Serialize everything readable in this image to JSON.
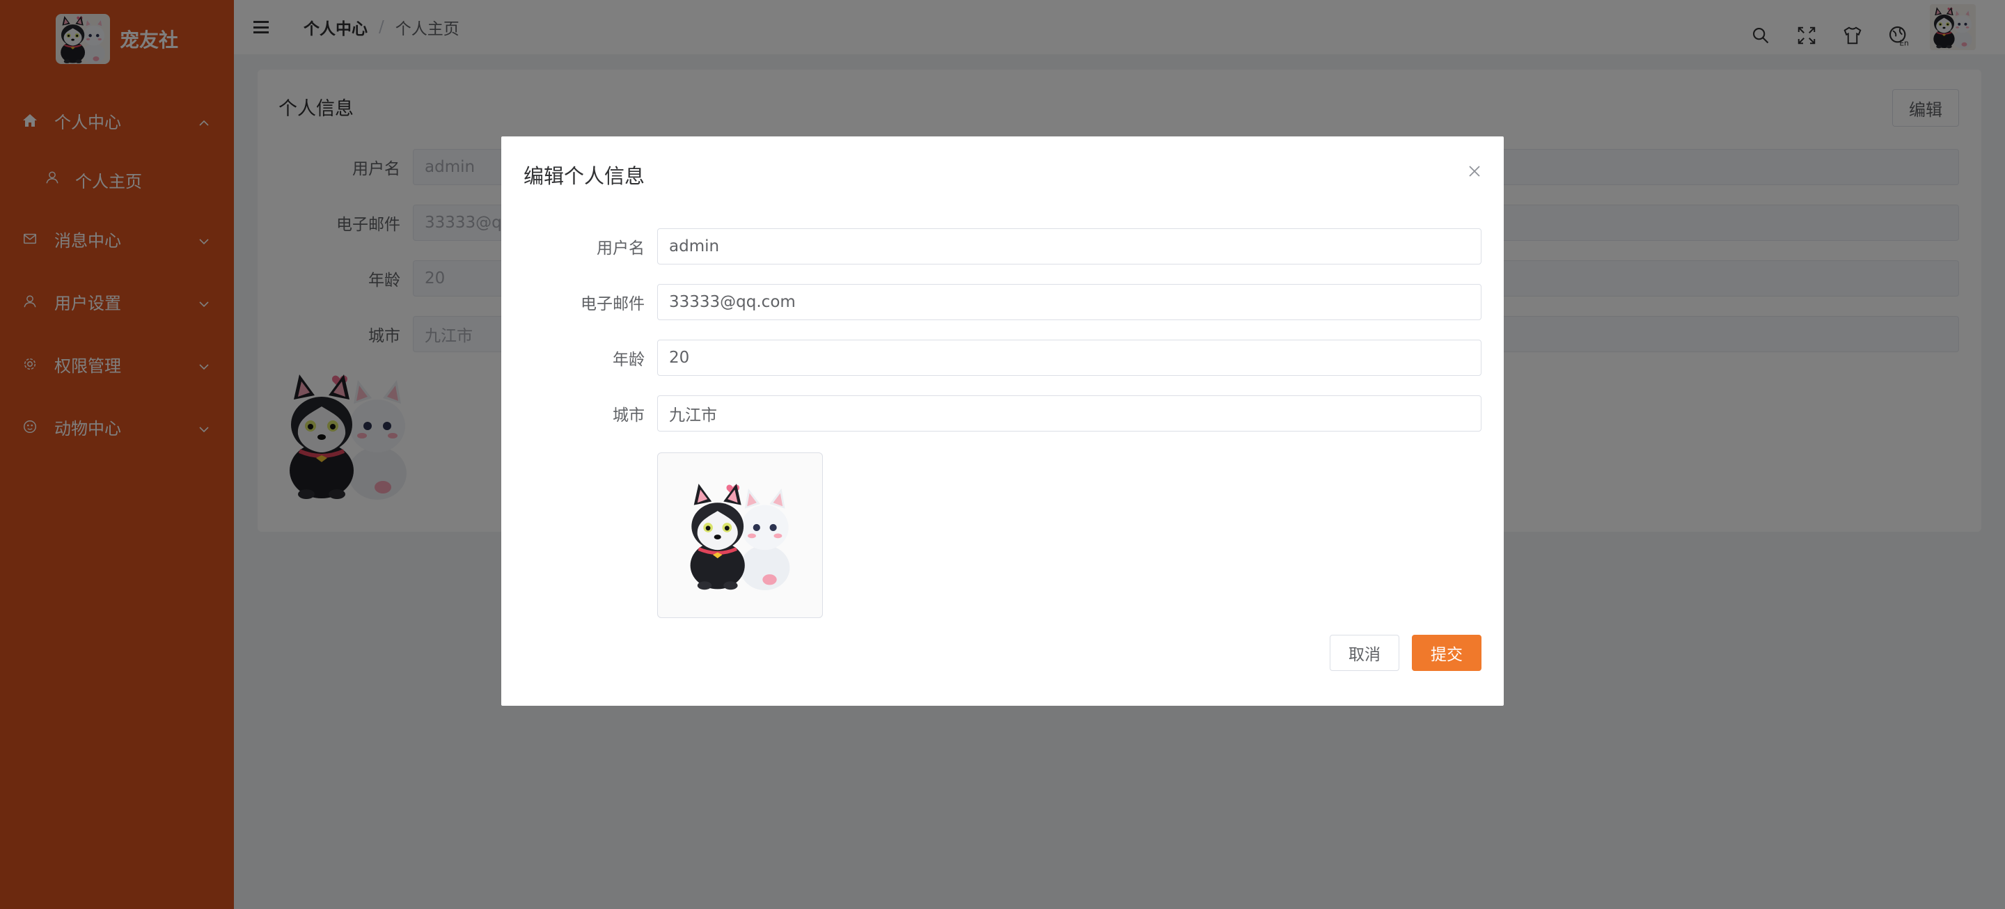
{
  "app": {
    "name": "宠友社"
  },
  "sidebar": {
    "items": [
      {
        "label": "个人中心",
        "icon": "home-icon",
        "expanded": true
      },
      {
        "label": "消息中心",
        "icon": "mail-icon",
        "expanded": false
      },
      {
        "label": "用户设置",
        "icon": "user-icon",
        "expanded": false
      },
      {
        "label": "权限管理",
        "icon": "gear-icon",
        "expanded": false
      },
      {
        "label": "动物中心",
        "icon": "paw-icon",
        "expanded": false
      }
    ],
    "subitems": [
      {
        "label": "个人主页",
        "icon": "user-icon"
      }
    ],
    "color": "#d9531e"
  },
  "header": {
    "breadcrumb": [
      "个人中心",
      "个人主页"
    ],
    "icons": [
      "search-icon",
      "fullscreen-icon",
      "shirt-icon",
      "language-icon"
    ]
  },
  "profile_card": {
    "title": "个人信息",
    "edit_label": "编辑",
    "fields": [
      {
        "label": "用户名",
        "value": "admin"
      },
      {
        "label": "电子邮件",
        "value": "33333@qq"
      },
      {
        "label": "年龄",
        "value": "20"
      },
      {
        "label": "城市",
        "value": "九江市"
      }
    ]
  },
  "dialog": {
    "title": "编辑个人信息",
    "fields": [
      {
        "label": "用户名",
        "value": "admin"
      },
      {
        "label": "电子邮件",
        "value": "33333@qq.com"
      },
      {
        "label": "年龄",
        "value": "20"
      },
      {
        "label": "城市",
        "value": "九江市"
      }
    ],
    "cancel_label": "取消",
    "submit_label": "提交",
    "accent": "#f0792b"
  }
}
